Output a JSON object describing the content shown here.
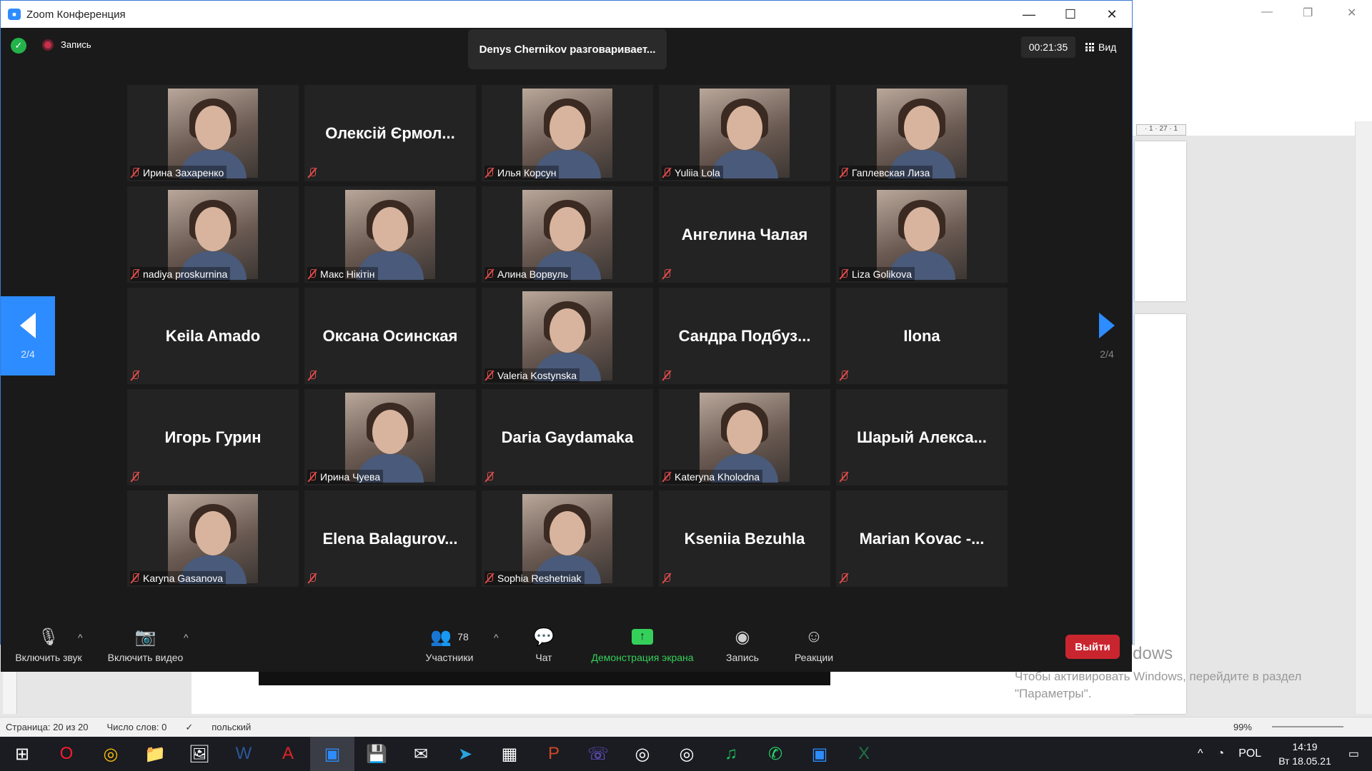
{
  "window": {
    "title": "Zoom Конференция",
    "minimize": "—",
    "maximize": "☐",
    "close": "✕"
  },
  "top": {
    "recording_label": "Запись",
    "speaking": "Denys Chernikov разговаривает...",
    "timer": "00:21:35",
    "view_label": "Вид"
  },
  "pager": {
    "prev_label": "2/4",
    "next_label": "2/4"
  },
  "participants": [
    {
      "name": "Ирина Захаренко",
      "video": true
    },
    {
      "name": "Олексій Єрмол...",
      "video": false
    },
    {
      "name": "Илья Корсун",
      "video": true
    },
    {
      "name": "Yuliia Lola",
      "video": true
    },
    {
      "name": "Гаплевская Лиза",
      "video": true
    },
    {
      "name": "nadiya proskurnina",
      "video": true
    },
    {
      "name": "Макс Нікітін",
      "video": true
    },
    {
      "name": "Алина Ворвуль",
      "video": true
    },
    {
      "name": "Ангелина Чалая",
      "video": false
    },
    {
      "name": "Liza Golikova",
      "video": true
    },
    {
      "name": "Keila Amado",
      "video": false
    },
    {
      "name": "Оксана Осинская",
      "video": false
    },
    {
      "name": "Valeria Kostynska",
      "video": true
    },
    {
      "name": "Сандра Подбуз...",
      "video": false
    },
    {
      "name": "Ilona",
      "video": false
    },
    {
      "name": "Игорь Гурин",
      "video": false
    },
    {
      "name": "Ирина Чуева",
      "video": true
    },
    {
      "name": "Daria Gaydamaka",
      "video": false
    },
    {
      "name": "Kateryna Kholodna",
      "video": true
    },
    {
      "name": "Шарый Алекса...",
      "video": false
    },
    {
      "name": "Karyna Gasanova",
      "video": true
    },
    {
      "name": "Elena Balagurov...",
      "video": false
    },
    {
      "name": "Sophia Reshetniak",
      "video": true
    },
    {
      "name": "Kseniia Bezuhla",
      "video": false
    },
    {
      "name": "Marian Kovac -...",
      "video": false
    }
  ],
  "toolbar": {
    "audio": "Включить звук",
    "video": "Включить видео",
    "participants": "Участники",
    "participants_count": "78",
    "chat": "Чат",
    "share": "Демонстрация экрана",
    "record": "Запись",
    "reactions": "Реакции",
    "leave": "Выйти"
  },
  "word": {
    "ruler": "· 1 · 27 · 1",
    "activation_title": "Активация Windows",
    "activation_text": "Чтобы активировать Windows, перейдите в раздел \"Параметры\".",
    "status_page": "Страница: 20 из 20",
    "status_words": "Число слов: 0",
    "status_lang": "польский",
    "zoom_level": "99%"
  },
  "taskbar": {
    "lang": "POL",
    "time": "14:19",
    "date": "Вт 18.05.21",
    "apps": [
      "windows-icon",
      "opera-icon",
      "chrome-icon",
      "explorer-icon",
      "photos-icon",
      "word-icon",
      "acrobat-icon",
      "zoom-icon",
      "save-icon",
      "mail-icon",
      "telegram-icon",
      "calculator-icon",
      "powerpoint-icon",
      "viber-icon",
      "chrome-profile-icon",
      "chrome-profile2-icon",
      "spotify-icon",
      "whatsapp-icon",
      "zoom2-icon",
      "excel-icon"
    ]
  }
}
